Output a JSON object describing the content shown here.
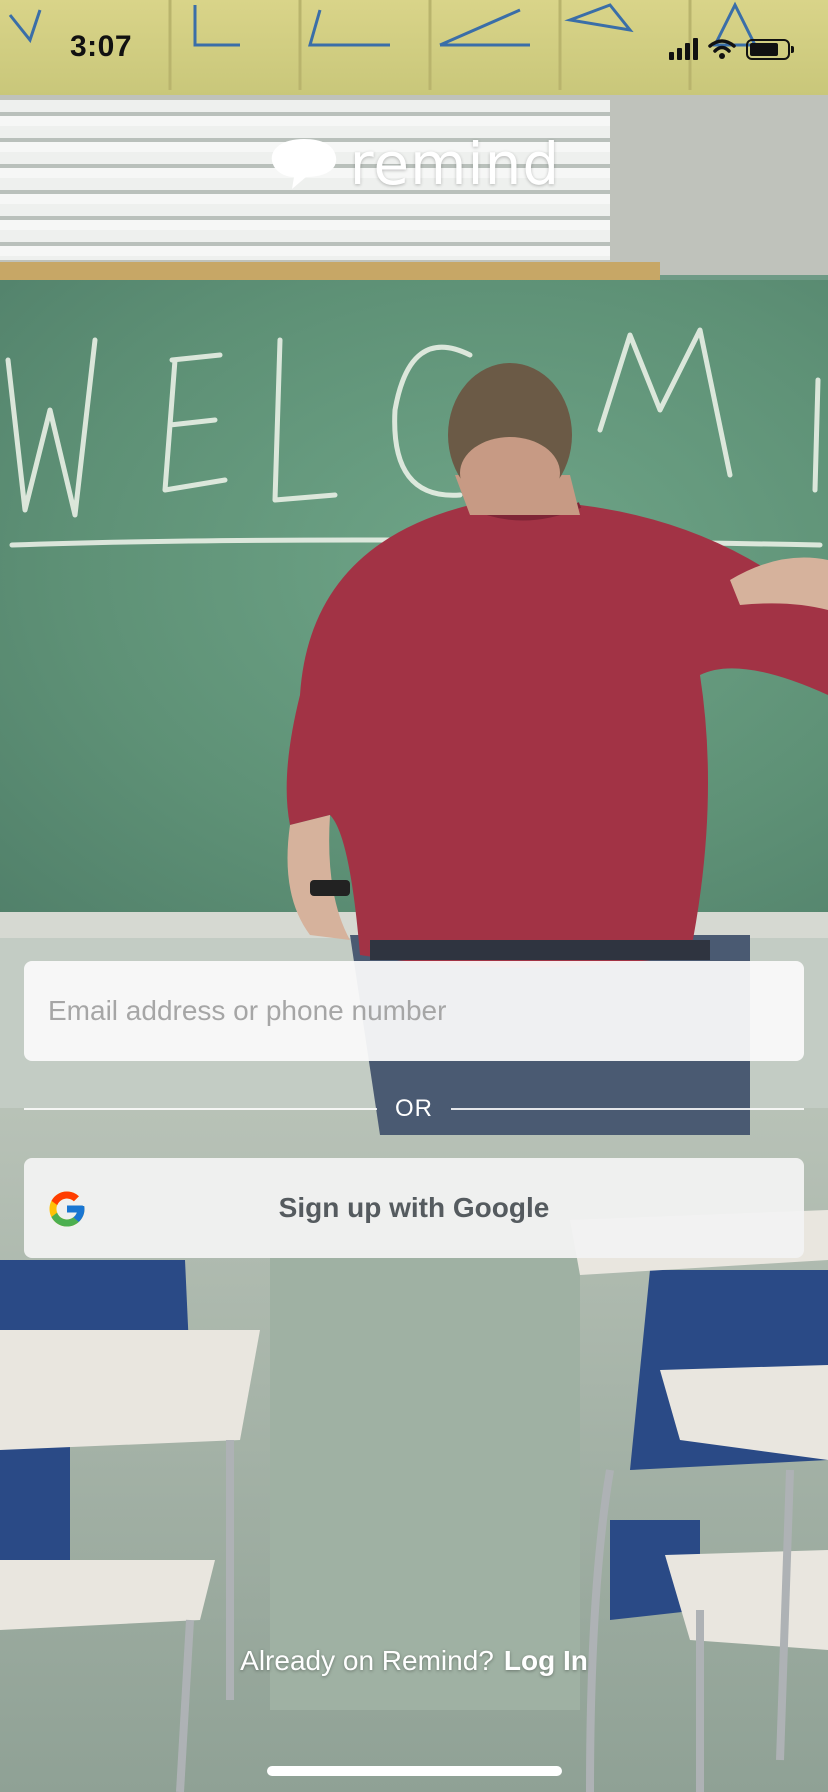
{
  "status_bar": {
    "time": "3:07",
    "icons": [
      "cellular-signal-icon",
      "wifi-icon",
      "battery-icon"
    ]
  },
  "app": {
    "logo_text": "remind",
    "logo_icon": "speech-bubble-icon"
  },
  "form": {
    "email_placeholder": "Email address or phone number",
    "email_value": "",
    "divider_text": "OR",
    "google_button_label": "Sign up with Google",
    "google_icon": "google-g-icon"
  },
  "footer": {
    "login_prompt": "Already on Remind?",
    "login_link": "Log In"
  },
  "colors": {
    "chalkboard": "#5e9176",
    "shirt": "#a23345",
    "field_background": "#fafafa",
    "text_muted": "#a6a6a6",
    "google_label": "#555b5f",
    "white": "#ffffff"
  }
}
